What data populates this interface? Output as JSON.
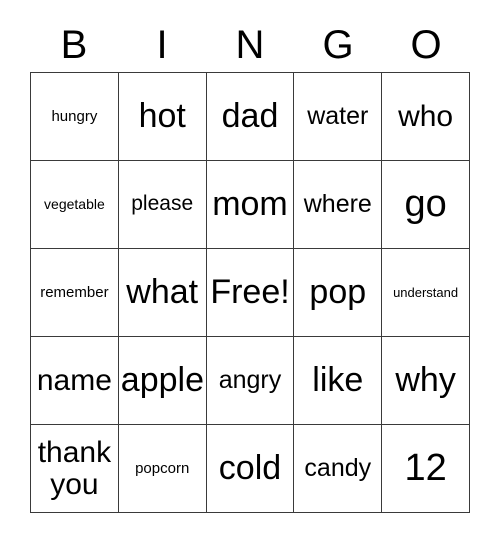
{
  "card": {
    "title": "BINGO Card",
    "header_letters": [
      "B",
      "I",
      "N",
      "G",
      "O"
    ],
    "free_space_label": "Free!",
    "colors": {
      "background": "#ffffff",
      "border": "#3a3a3a",
      "text": "#000000"
    },
    "grid": {
      "columns": 5,
      "rows": 5,
      "cells": [
        [
          {
            "text": "hungry",
            "size": "smp"
          },
          {
            "text": "hot",
            "size": "xxl"
          },
          {
            "text": "dad",
            "size": "xxl"
          },
          {
            "text": "water",
            "size": "lg"
          },
          {
            "text": "who",
            "size": "xl"
          }
        ],
        [
          {
            "text": "vegetable",
            "size": "sm"
          },
          {
            "text": "please",
            "size": "md"
          },
          {
            "text": "mom",
            "size": "xxl"
          },
          {
            "text": "where",
            "size": "lg"
          },
          {
            "text": "go",
            "size": "huge"
          }
        ],
        [
          {
            "text": "remember",
            "size": "smp"
          },
          {
            "text": "what",
            "size": "xxl"
          },
          {
            "text": "Free!",
            "size": "xxl"
          },
          {
            "text": "pop",
            "size": "xxl"
          },
          {
            "text": "understand",
            "size": "xs"
          }
        ],
        [
          {
            "text": "name",
            "size": "xl"
          },
          {
            "text": "apple",
            "size": "xxl"
          },
          {
            "text": "angry",
            "size": "lg"
          },
          {
            "text": "like",
            "size": "xxl"
          },
          {
            "text": "why",
            "size": "xxl"
          }
        ],
        [
          {
            "text": "thank\nyou",
            "size": "xl"
          },
          {
            "text": "popcorn",
            "size": "smp"
          },
          {
            "text": "cold",
            "size": "xxl"
          },
          {
            "text": "candy",
            "size": "lg"
          },
          {
            "text": "12",
            "size": "huge"
          }
        ]
      ]
    }
  }
}
